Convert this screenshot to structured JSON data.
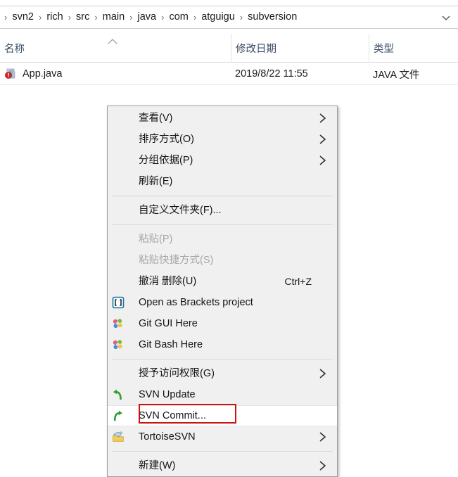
{
  "explorer": {
    "breadcrumb": {
      "separator": "›",
      "items": [
        "svn2",
        "rich",
        "src",
        "main",
        "java",
        "com",
        "atguigu",
        "subversion"
      ],
      "dropdown_icon": "chevron-down-icon"
    },
    "columns": [
      {
        "key": "name",
        "label": "名称",
        "sort": "ascending"
      },
      {
        "key": "date",
        "label": "修改日期",
        "sort": "none"
      },
      {
        "key": "type",
        "label": "类型",
        "sort": "none"
      }
    ],
    "files": [
      {
        "icon": "java-file-icon",
        "name": "App.java",
        "date": "2019/8/22 11:55",
        "type": "JAVA 文件"
      }
    ]
  },
  "context_menu": {
    "items": [
      {
        "id": "view",
        "label": "查看(V)",
        "icon": null,
        "accel": "",
        "submenu": true,
        "disabled": false,
        "hovered": false
      },
      {
        "id": "sort-by",
        "label": "排序方式(O)",
        "icon": null,
        "accel": "",
        "submenu": true,
        "disabled": false,
        "hovered": false
      },
      {
        "id": "group-by",
        "label": "分组依据(P)",
        "icon": null,
        "accel": "",
        "submenu": true,
        "disabled": false,
        "hovered": false
      },
      {
        "id": "refresh",
        "label": "刷新(E)",
        "icon": null,
        "accel": "",
        "submenu": false,
        "disabled": false,
        "hovered": false
      },
      {
        "id": "sep1",
        "separator": true
      },
      {
        "id": "customize",
        "label": "自定义文件夹(F)...",
        "icon": null,
        "accel": "",
        "submenu": false,
        "disabled": false,
        "hovered": false
      },
      {
        "id": "sep2",
        "separator": true
      },
      {
        "id": "paste",
        "label": "粘贴(P)",
        "icon": null,
        "accel": "",
        "submenu": false,
        "disabled": true,
        "hovered": false
      },
      {
        "id": "paste-shortcut",
        "label": "粘贴快捷方式(S)",
        "icon": null,
        "accel": "",
        "submenu": false,
        "disabled": true,
        "hovered": false
      },
      {
        "id": "undo-delete",
        "label": "撤消 删除(U)",
        "icon": null,
        "accel": "Ctrl+Z",
        "submenu": false,
        "disabled": false,
        "hovered": false
      },
      {
        "id": "brackets",
        "label": "Open as Brackets project",
        "icon": "brackets-icon",
        "accel": "",
        "submenu": false,
        "disabled": false,
        "hovered": false
      },
      {
        "id": "git-gui",
        "label": "Git GUI Here",
        "icon": "git-icon",
        "accel": "",
        "submenu": false,
        "disabled": false,
        "hovered": false
      },
      {
        "id": "git-bash",
        "label": "Git Bash Here",
        "icon": "git-icon",
        "accel": "",
        "submenu": false,
        "disabled": false,
        "hovered": false
      },
      {
        "id": "sep3",
        "separator": true
      },
      {
        "id": "grant-access",
        "label": "授予访问权限(G)",
        "icon": null,
        "accel": "",
        "submenu": true,
        "disabled": false,
        "hovered": false
      },
      {
        "id": "svn-update",
        "label": "SVN Update",
        "icon": "svn-update-icon",
        "accel": "",
        "submenu": false,
        "disabled": false,
        "hovered": false
      },
      {
        "id": "svn-commit",
        "label": "SVN Commit...",
        "icon": "svn-commit-icon",
        "accel": "",
        "submenu": false,
        "disabled": false,
        "hovered": true
      },
      {
        "id": "tortoisesvn",
        "label": "TortoiseSVN",
        "icon": "tortoisesvn-icon",
        "accel": "",
        "submenu": true,
        "disabled": false,
        "hovered": false
      },
      {
        "id": "sep4",
        "separator": true
      },
      {
        "id": "new",
        "label": "新建(W)",
        "icon": null,
        "accel": "",
        "submenu": true,
        "disabled": false,
        "hovered": false
      }
    ],
    "annotation": {
      "target": "svn-commit",
      "shape": "rectangle",
      "color": "#cc1212"
    }
  },
  "colors": {
    "menu_background": "#f0f0f0",
    "menu_border": "#9c9c9c",
    "hover_background": "#ffffff",
    "header_text": "#3b4c64",
    "disabled_text": "#a6a6a6",
    "annotation_red": "#cc1212"
  }
}
